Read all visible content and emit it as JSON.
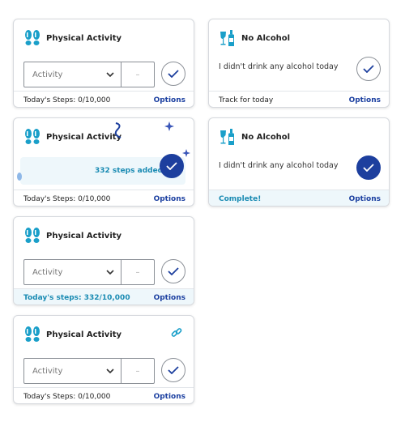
{
  "colors": {
    "brand": "#1d3f9e",
    "accent": "#1a8bb3",
    "icon": "#1a9fc9"
  },
  "cards": {
    "pa1": {
      "title": "Physical Activity",
      "activity_placeholder": "Activity",
      "qty_placeholder": "–",
      "footer": "Today's Steps: 0/10,000",
      "options": "Options"
    },
    "na1": {
      "title": "No Alcohol",
      "statement": "I didn't drink any alcohol today",
      "footer": "Track for today",
      "options": "Options"
    },
    "pa2": {
      "title": "Physical Activity",
      "banner": "332 steps added!",
      "footer": "Today's Steps: 0/10,000",
      "options": "Options"
    },
    "na2": {
      "title": "No Alcohol",
      "statement": "I didn't drink any alcohol today",
      "footer": "Complete!",
      "options": "Options"
    },
    "pa3": {
      "title": "Physical Activity",
      "activity_placeholder": "Activity",
      "qty_placeholder": "–",
      "footer": "Today's steps: 332/10,000",
      "options": "Options"
    },
    "pa4": {
      "title": "Physical Activity",
      "activity_placeholder": "Activity",
      "qty_placeholder": "–",
      "footer": "Today's Steps: 0/10,000",
      "options": "Options"
    }
  }
}
